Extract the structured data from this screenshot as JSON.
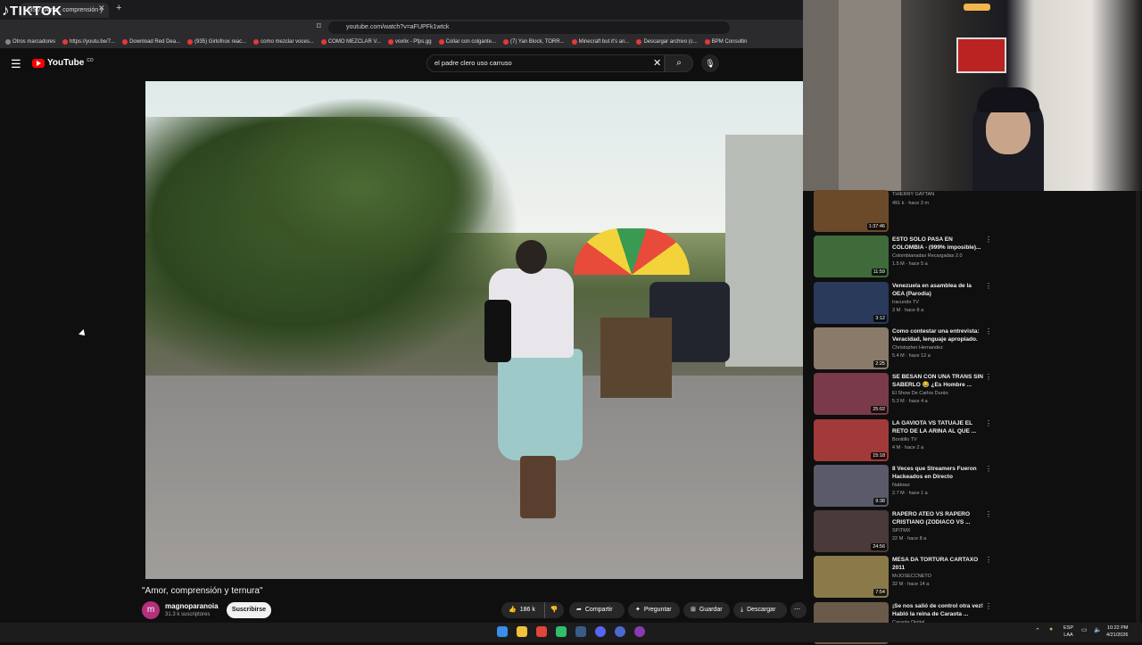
{
  "browser": {
    "overlay_brand": "TIKTOK",
    "tab_title": "(35/7) Amor, comprensión y",
    "url": "youtube.com/watch?v=aFUPFk1wtck",
    "bookmarks": [
      "Otros marcadores",
      "https://youtu.be/7...",
      "Download Red Dea...",
      "(935) Girlofnox reac...",
      "como mezclar voces...",
      "COMO MEZCLAR V...",
      "voxlix - Pfps.gg",
      "Collar con colgante...",
      "(7) Yan Block, TORR...",
      "Minecraft but it's an...",
      "Descargar archivo (c...",
      "BPM Consultin"
    ]
  },
  "youtube": {
    "logo_text": "YouTube",
    "logo_country": "CO",
    "search_value": "el padre clero uso carruso"
  },
  "video": {
    "title": "\"Amor, comprensión y ternura\"",
    "channel_initial": "m",
    "channel_name": "magnoparanoia",
    "channel_subs": "31.3 k suscriptores",
    "subscribe_label": "Suscribirse",
    "likes": "186 k",
    "share_label": "Compartir",
    "ask_label": "Preguntar",
    "save_label": "Guardar",
    "download_label": "Descargar"
  },
  "recommendations": [
    {
      "title": "",
      "channel": "THIERRY GAYTAN",
      "stats": "491 k · hace 3 m",
      "duration": "1:37:46",
      "color": "#6b4a2a"
    },
    {
      "title": "ESTO SOLO PASA EN COLOMBIA - (999% imposible)...",
      "channel": "Colombianadas Recargadas 2.0",
      "stats": "1.5 M · hace 5 a",
      "duration": "11:59",
      "color": "#3f6b3a"
    },
    {
      "title": "Venezuela en asamblea de la OEA (Parodia)",
      "channel": "Iracundo TV",
      "stats": "3 M · hace 8 a",
      "duration": "3:12",
      "color": "#2a3a5a"
    },
    {
      "title": "Como contestar una entrevista: Veracidad, lenguaje apropiado.",
      "channel": "Christopher Hernandez",
      "stats": "5.4 M · hace 12 a",
      "duration": "2:25",
      "color": "#8a7a6a"
    },
    {
      "title": "SE BESAN CON UNA TRANS SIN SABERLO 😂 ¿Es Hombre ...",
      "channel": "El Show De Carlos Durán",
      "stats": "5.3 M · hace 4 a",
      "duration": "25:02",
      "color": "#7a3a4a"
    },
    {
      "title": "LA GAVIOTA VS TATUAJE EL RETO DE LA ARINA AL QUE ...",
      "channel": "Bonitillo TV",
      "stats": "4 M · hace 2 a",
      "duration": "15:18",
      "color": "#a23a3a"
    },
    {
      "title": "8 Veces que Streamers Fueron Hackeados en Directo",
      "channel": "Nattowz",
      "stats": "2.7 M · hace 1 a",
      "duration": "9:38",
      "color": "#5a5a6a"
    },
    {
      "title": "RAPERO ATEO VS RAPERO CRISTIANO (ZODIACO VS ...",
      "channel": "SPITMX",
      "stats": "22 M · hace 8 a",
      "duration": "24:56",
      "color": "#4a3a3a"
    },
    {
      "title": "MESA DA TORTURA CARTAXO 2011",
      "channel": "MrJOSECCNETO",
      "stats": "32 M · hace 14 a",
      "duration": "7:54",
      "color": "#8a7a4a"
    },
    {
      "title": "¡Se nos salió de control otra vez! Habló la reina de Caraota ...",
      "channel": "Caraota Digital",
      "stats": "2.2 M · hace 6 a",
      "duration": "",
      "color": "#6a5a4a"
    }
  ],
  "taskbar": {
    "lang_top": "ESP",
    "lang_bottom": "LAA",
    "time": "10:22 PM",
    "date": "4/21/2026"
  }
}
